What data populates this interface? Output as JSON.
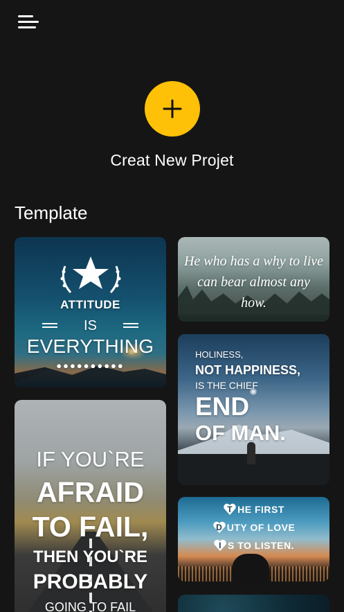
{
  "header": {
    "menu_icon": "hamburger-menu-icon"
  },
  "create": {
    "label": "Creat New Projet",
    "icon": "plus-icon",
    "color": "#FFC107"
  },
  "templates": {
    "title": "Template",
    "attitude": {
      "line1": "ATTITUDE",
      "line2": "IS",
      "line3": "EVERYTHING",
      "dots": "●●●●●●●●●●"
    },
    "quote": {
      "text": "He who has a why to live can bear almost any how."
    },
    "holiness": {
      "line1": "HOLINESS,",
      "line2": "NOT HAPPINESS,",
      "line3": "IS THE CHIEF",
      "line4": "END",
      "line5": "OF MAN."
    },
    "afraid": {
      "line1": "IF YOU`RE",
      "line2": "AFRAID",
      "line3": "TO FAIL,",
      "line4": "THEN YOU`RE",
      "line5": "PROBABLY",
      "line6": "GOING TO FAIL"
    },
    "love": {
      "r1_letter": "T",
      "r1_rest": "HE FIRST",
      "r2_letter": "D",
      "r2_rest": "UTY OF LOVE",
      "r3_letter": "I",
      "r3_rest": "S TO LISTEN."
    }
  }
}
